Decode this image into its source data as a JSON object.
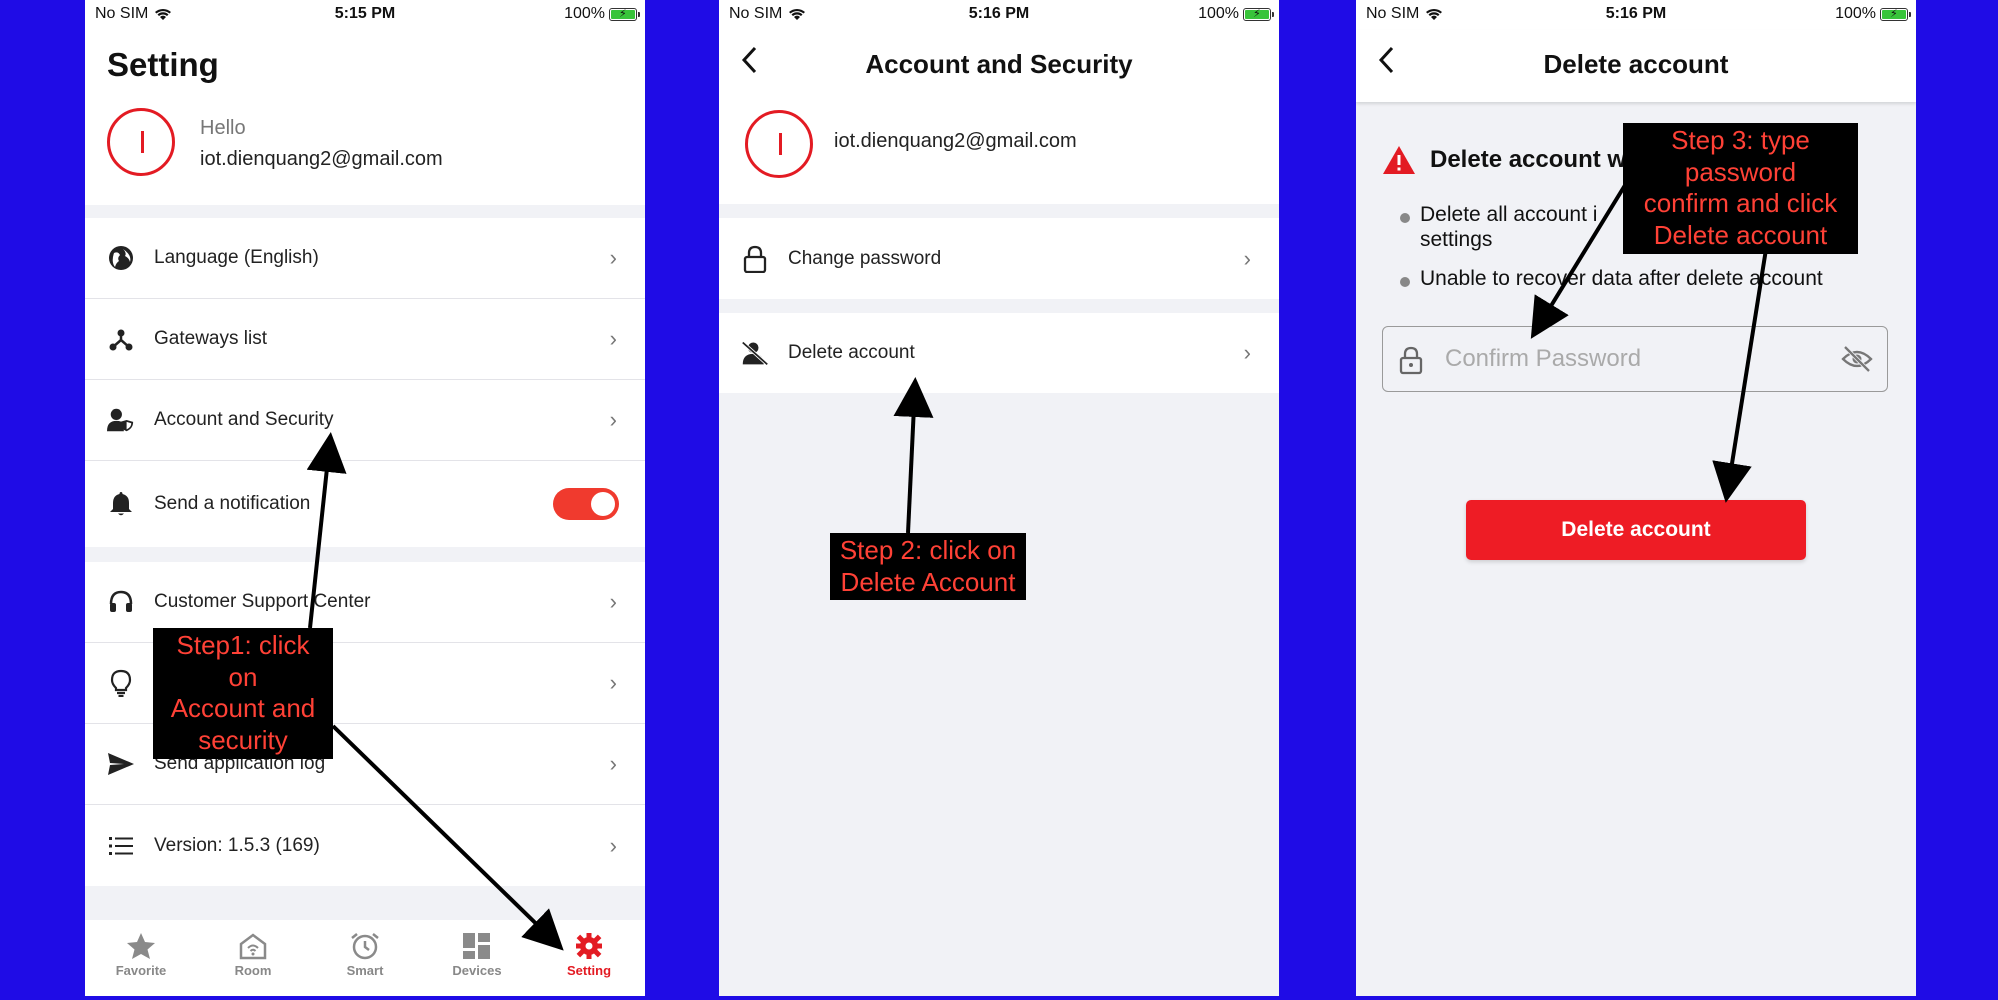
{
  "status_bars": [
    {
      "carrier": "No SIM",
      "time": "5:15 PM",
      "battery": "100%"
    },
    {
      "carrier": "No SIM",
      "time": "5:16 PM",
      "battery": "100%"
    },
    {
      "carrier": "No SIM",
      "time": "5:16 PM",
      "battery": "100%"
    }
  ],
  "screen1": {
    "title": "Setting",
    "greeting": "Hello",
    "email": "iot.dienquang2@gmail.com",
    "menu": [
      {
        "label": "Language (English)",
        "icon": "globe-icon"
      },
      {
        "label": "Gateways list",
        "icon": "gateway-icon"
      },
      {
        "label": "Account and Security",
        "icon": "user-shield-icon"
      },
      {
        "label": "Send a notification",
        "icon": "bell-icon",
        "toggle": true
      },
      {
        "label": "Customer Support Center",
        "icon": "headset-icon"
      },
      {
        "label": "",
        "icon": "lightbulb-icon"
      },
      {
        "label": "Send application log",
        "icon": "send-icon"
      },
      {
        "label": "Version: 1.5.3 (169)",
        "icon": "list-icon"
      }
    ],
    "tabs": [
      {
        "label": "Favorite",
        "icon": "star-icon"
      },
      {
        "label": "Room",
        "icon": "home-icon"
      },
      {
        "label": "Smart",
        "icon": "alarm-icon"
      },
      {
        "label": "Devices",
        "icon": "grid-icon"
      },
      {
        "label": "Setting",
        "icon": "gear-icon",
        "active": true
      }
    ]
  },
  "screen2": {
    "title": "Account and Security",
    "email": "iot.dienquang2@gmail.com",
    "items": [
      {
        "label": "Change password",
        "icon": "lock-icon"
      },
      {
        "label": "Delete account",
        "icon": "user-slash-icon"
      }
    ]
  },
  "screen3": {
    "title": "Delete account",
    "warning_title": "Delete account w",
    "bullets": [
      "Delete all account i",
      "settings",
      "Unable to recover data after delete account"
    ],
    "password_placeholder": "Confirm Password",
    "button_label": "Delete account"
  },
  "annotations": {
    "step1": [
      "Step1: click on",
      "Account and",
      "security"
    ],
    "step2": [
      "Step 2: click on",
      "Delete Account"
    ],
    "step3": [
      "Step 3: type password",
      "confirm and click",
      "Delete account"
    ]
  },
  "colors": {
    "background": "#1f0ce6",
    "accent_red": "#e31b23",
    "annotation_text": "#ff4136"
  }
}
